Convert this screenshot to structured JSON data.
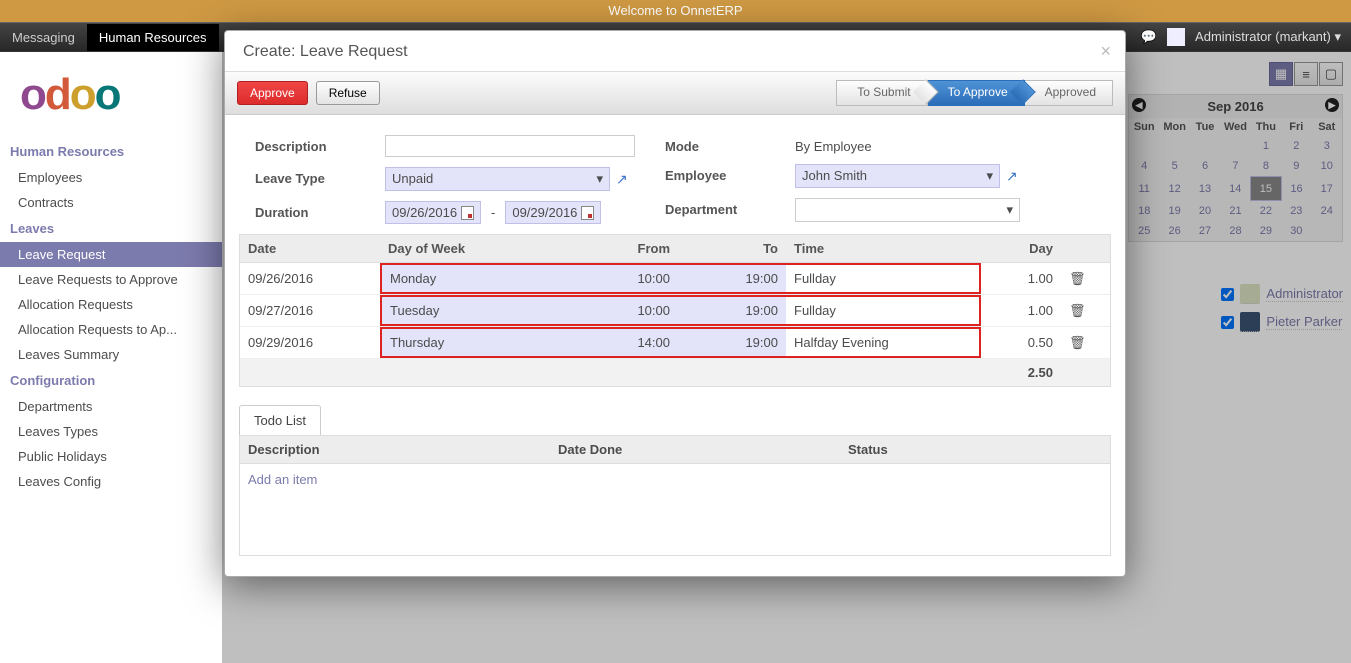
{
  "banner": "Welcome to OnnetERP",
  "top_menu": {
    "messaging": "Messaging",
    "hr": "Human Resources",
    "user": "Administrator (markant)"
  },
  "sidebar": {
    "section_hr": "Human Resources",
    "employees": "Employees",
    "contracts": "Contracts",
    "section_leaves": "Leaves",
    "leave_request": "Leave Request",
    "to_approve": "Leave Requests to Approve",
    "alloc": "Allocation Requests",
    "alloc_ap": "Allocation Requests to Ap...",
    "summary": "Leaves Summary",
    "section_config": "Configuration",
    "departments": "Departments",
    "leaves_types": "Leaves Types",
    "public_holidays": "Public Holidays",
    "leaves_config": "Leaves Config"
  },
  "calendar": {
    "title": "Sep 2016",
    "dow": [
      "Sun",
      "Mon",
      "Tue",
      "Wed",
      "Thu",
      "Fri",
      "Sat"
    ],
    "weeks": [
      [
        "",
        "",
        "",
        "",
        "1",
        "2",
        "3"
      ],
      [
        "4",
        "5",
        "6",
        "7",
        "8",
        "9",
        "10"
      ],
      [
        "11",
        "12",
        "13",
        "14",
        "15",
        "16",
        "17"
      ],
      [
        "18",
        "19",
        "20",
        "21",
        "22",
        "23",
        "24"
      ],
      [
        "25",
        "26",
        "27",
        "28",
        "29",
        "30",
        ""
      ]
    ],
    "selected": "15",
    "users": [
      "Administrator",
      "Pieter Parker"
    ]
  },
  "modal": {
    "title": "Create: Leave Request",
    "approve": "Approve",
    "refuse": "Refuse",
    "stages": {
      "submit": "To Submit",
      "approve": "To Approve",
      "approved": "Approved"
    },
    "labels": {
      "description": "Description",
      "leave_type": "Leave Type",
      "duration": "Duration",
      "mode": "Mode",
      "employee": "Employee",
      "department": "Department",
      "by_employee": "By Employee"
    },
    "values": {
      "leave_type": "Unpaid",
      "date_from": "09/26/2016",
      "date_to": "09/29/2016",
      "employee": "John Smith"
    },
    "grid": {
      "headers": {
        "date": "Date",
        "dow": "Day of Week",
        "from": "From",
        "to": "To",
        "time": "Time",
        "day": "Day"
      },
      "rows": [
        {
          "date": "09/26/2016",
          "dow": "Monday",
          "from": "10:00",
          "to": "19:00",
          "time": "Fullday",
          "day": "1.00",
          "red": true
        },
        {
          "date": "09/27/2016",
          "dow": "Tuesday",
          "from": "10:00",
          "to": "19:00",
          "time": "Fullday",
          "day": "1.00",
          "red": true
        },
        {
          "date": "09/29/2016",
          "dow": "Thursday",
          "from": "14:00",
          "to": "19:00",
          "time": "Halfday Evening",
          "day": "0.50",
          "red": true
        }
      ],
      "total": "2.50"
    },
    "todo": {
      "tab": "Todo List",
      "headers": {
        "desc": "Description",
        "done": "Date Done",
        "status": "Status"
      },
      "add": "Add an item"
    }
  }
}
